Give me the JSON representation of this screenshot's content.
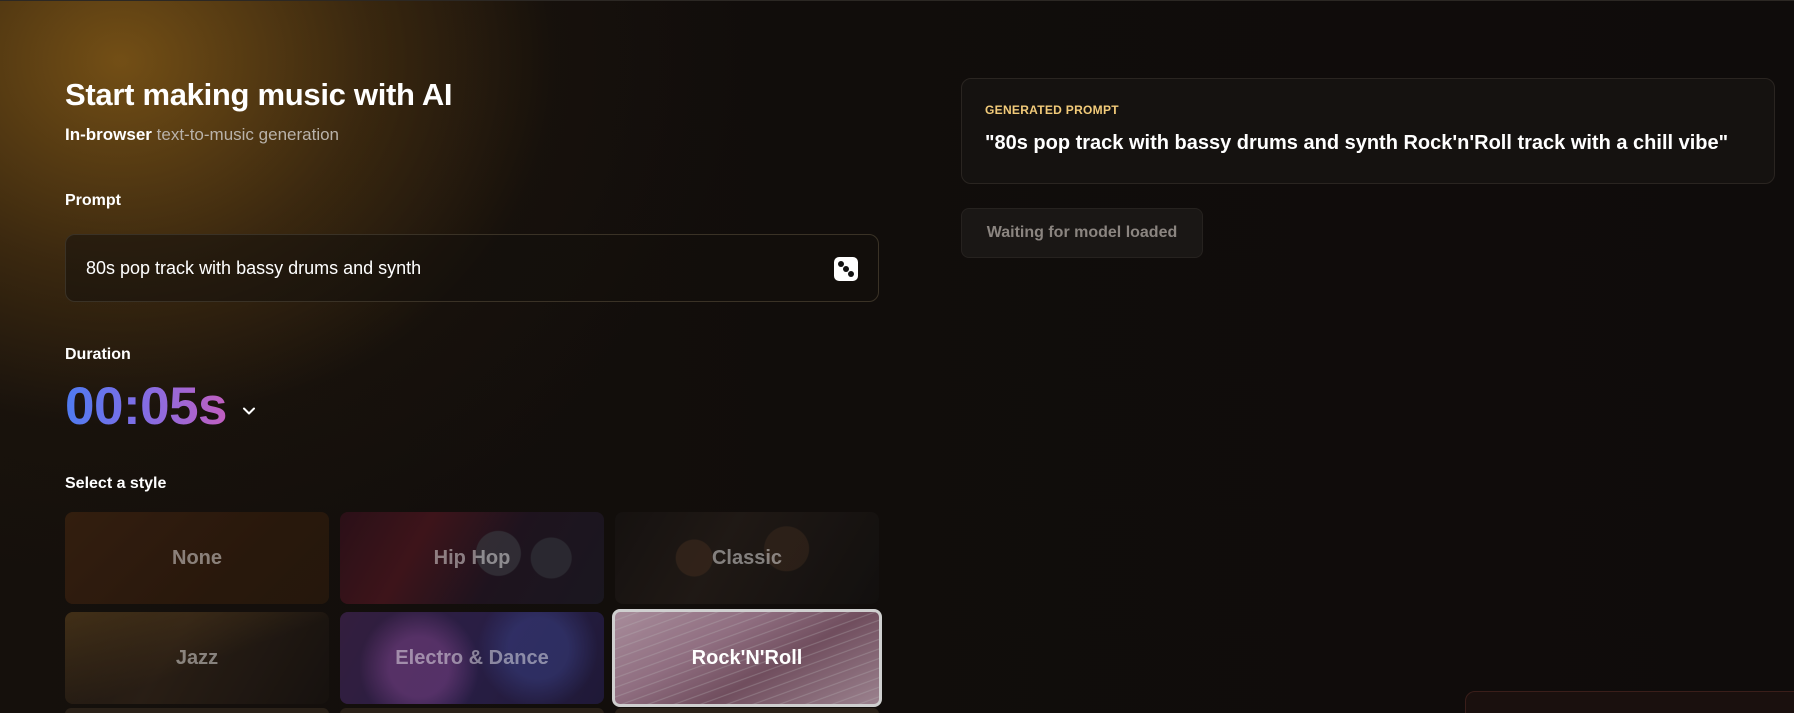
{
  "header": {
    "title": "Start making music with AI",
    "subtitle_strong": "In-browser",
    "subtitle_rest": "text-to-music generation"
  },
  "prompt": {
    "label": "Prompt",
    "value": "80s pop track with bassy drums and synth",
    "randomize_icon": "dice-icon"
  },
  "duration": {
    "label": "Duration",
    "value": "00:05s",
    "dropdown_icon": "chevron-down-icon"
  },
  "styles": {
    "label": "Select a style",
    "items": [
      {
        "label": "None",
        "selected": false
      },
      {
        "label": "Hip Hop",
        "selected": false
      },
      {
        "label": "Classic",
        "selected": false
      },
      {
        "label": "Jazz",
        "selected": false
      },
      {
        "label": "Electro & Dance",
        "selected": false
      },
      {
        "label": "Rock'N'Roll",
        "selected": true
      }
    ]
  },
  "generated": {
    "label": "GENERATED PROMPT",
    "text": "\"80s pop track with bassy drums and synth Rock'n'Roll track with a chill vibe\""
  },
  "status": {
    "text": "Waiting for model loaded"
  },
  "colors": {
    "accent_label": "#f2cb7a",
    "duration_gradient_start": "#4f7bf0",
    "duration_gradient_end": "#c15fc0",
    "background": "#0f0c0b"
  }
}
